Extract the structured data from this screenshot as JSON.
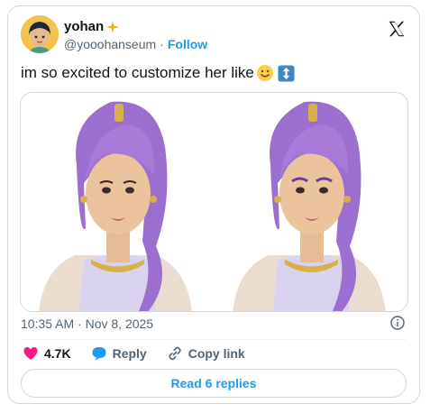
{
  "author": {
    "display_name": "yohan",
    "handle": "@yooohanseum",
    "follow_label": "Follow",
    "separator": "·"
  },
  "tweet": {
    "text": "im so excited to customize her like",
    "timestamp": "10:35 AM · Nov 8, 2025"
  },
  "actions": {
    "like_count": "4.7K",
    "reply_label": "Reply",
    "copy_link_label": "Copy link"
  },
  "read_replies_label": "Read 6 replies",
  "colors": {
    "accent": "#1d9bf0",
    "like": "#f91880",
    "text": "#0f1419",
    "muted": "#536471",
    "hair": "#9b6fd0"
  },
  "icons": {
    "sparkle": "sparkle-icon",
    "x_logo": "x-logo-icon",
    "emoji_face": "smiling-face-icon",
    "emoji_arrows": "up-down-arrow-icon",
    "info": "info-icon",
    "like": "heart-icon",
    "reply": "speech-bubble-icon",
    "link": "link-icon"
  }
}
